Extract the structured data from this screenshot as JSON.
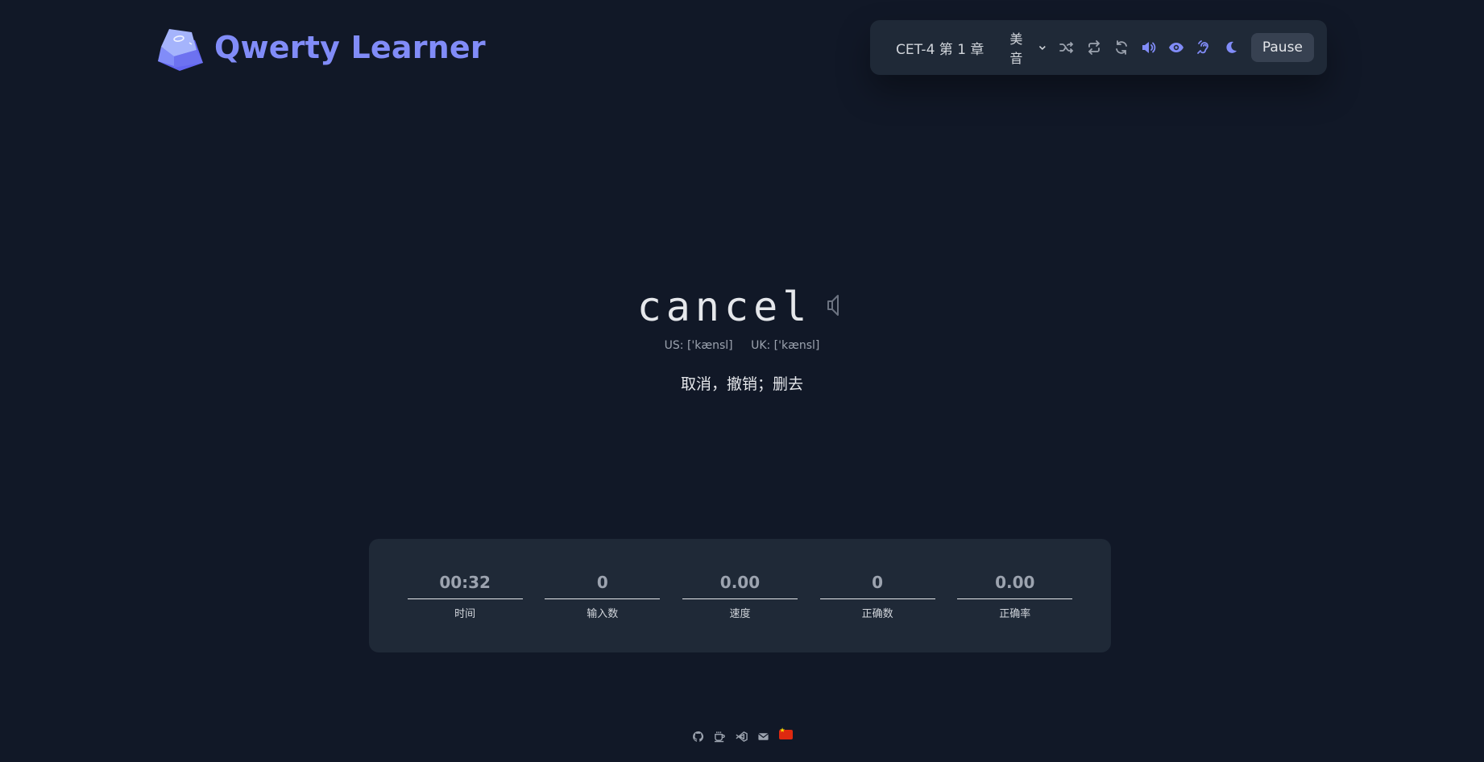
{
  "app": {
    "title": "Qwerty Learner"
  },
  "toolbar": {
    "dictionary": "CET-4 第 1 章",
    "accent": "美音",
    "icons": [
      "shuffle-icon",
      "repeat-icon",
      "refresh-icon",
      "volume-icon",
      "eye-icon",
      "hearing-icon",
      "moon-icon"
    ],
    "pause_label": "Pause",
    "accent_color": "#818cf8"
  },
  "word": {
    "text": "cancel",
    "us_phonetic": "US: ['kænsl]",
    "uk_phonetic": "UK: ['kænsl]",
    "meaning": "取消，撤销；删去"
  },
  "stats": [
    {
      "value": "00:32",
      "label": "时间"
    },
    {
      "value": "0",
      "label": "输入数"
    },
    {
      "value": "0.00",
      "label": "速度"
    },
    {
      "value": "0",
      "label": "正确数"
    },
    {
      "value": "0.00",
      "label": "正确率"
    }
  ],
  "footer": {
    "icons": [
      "github-icon",
      "coffee-icon",
      "vscode-icon",
      "mail-icon",
      "china-flag-icon"
    ]
  }
}
